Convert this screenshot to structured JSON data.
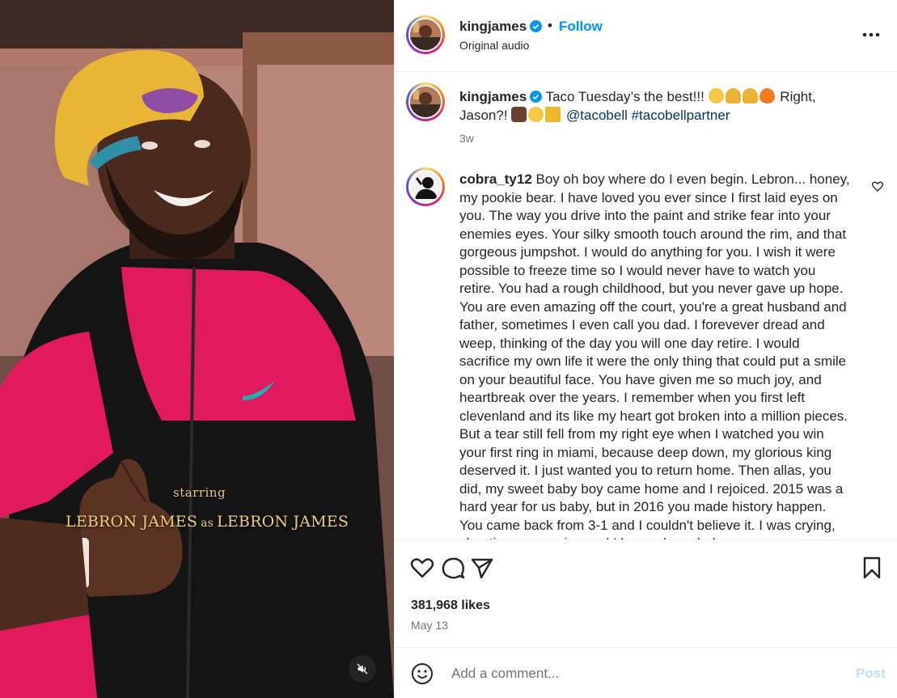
{
  "media": {
    "caption_starring": "starring",
    "caption_name_left": "LEBRON JAMES",
    "caption_as": "as",
    "caption_name_right": "LEBRON JAMES",
    "mute_icon": "speaker-muted-icon"
  },
  "header": {
    "username": "kingjames",
    "separator": "•",
    "follow_label": "Follow",
    "audio_label": "Original audio",
    "more_icon": "more-horizontal-icon"
  },
  "caption": {
    "username": "kingjames",
    "text_part1": "Taco Tuesday’s the best!!!",
    "text_part2": "Right, Jason?!",
    "mentions": "@tacobell #tacobellpartner",
    "timestamp": "3w"
  },
  "comment": {
    "username": "cobra_ty12",
    "text": "Boy oh boy where do I even begin. Lebron... honey, my pookie bear. I have loved you ever since I first laid eyes on you. The way you drive into the paint and strike fear into your enemies eyes. Your silky smooth touch around the rim, and that gorgeous jumpshot. I would do anything for you. I wish it were possible to freeze time so I would never have to watch you retire. You had a rough childhood, but you never gave up hope. You are even amazing off the court, you're a great husband and father, sometimes I even call you dad. I forevever dread and weep, thinking of the day you will one day retire. I would sacrifice my own life it were the only thing that could put a smile on your beautiful face. You have given me so much joy, and heartbreak over the years. I remember when you first left clevenland and its like my heart got broken into a million pieces. But a tear still fell from my right eye when I watched you win your first ring in miami, because deep down, my glorious king deserved it. I just wanted you to return home. Then allas, you did, my sweet baby boy came home and I rejoiced. 2015 was a hard year for us baby, but in 2016 you made history happen. You came back from 3-1 and I couldn't believe it. I was crying, shouting, screaming and I hugged my dad."
  },
  "actions": {
    "like_icon": "heart-icon",
    "comment_icon": "comment-icon",
    "share_icon": "share-icon",
    "save_icon": "bookmark-icon",
    "likes_text": "381,968 likes",
    "date": "May 13"
  },
  "add_comment": {
    "emoji_icon": "smiley-icon",
    "placeholder": "Add a comment...",
    "post_label": "Post"
  },
  "colors": {
    "accent": "#0095f6",
    "link": "#00376b",
    "secondary_text": "#737373",
    "post_disabled": "#c0dffd"
  }
}
